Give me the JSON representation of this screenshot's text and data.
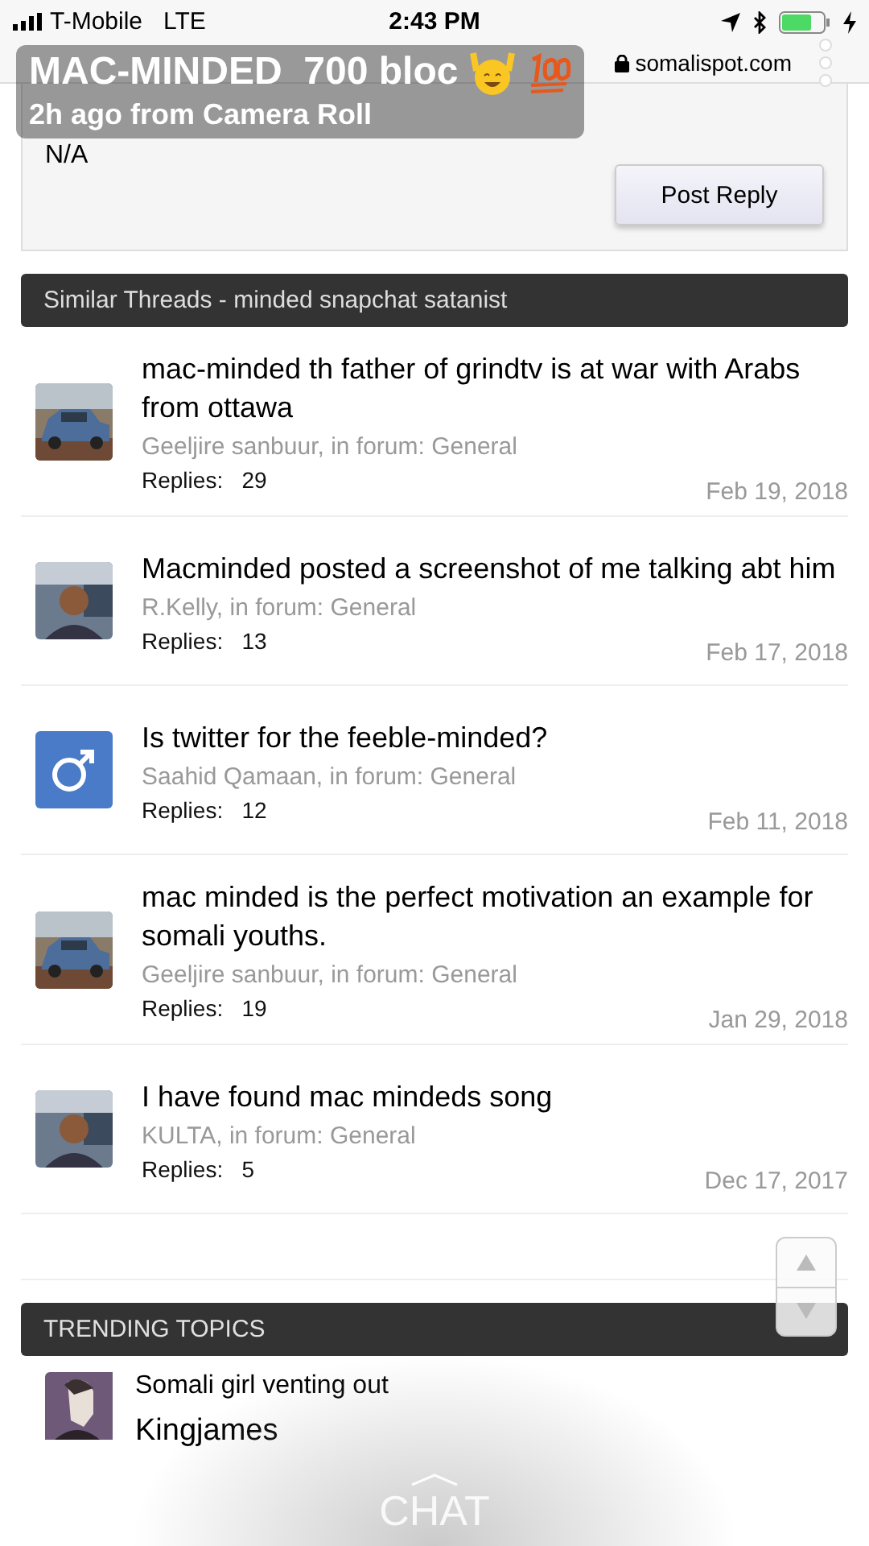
{
  "status_bar": {
    "carrier": "T-Mobile",
    "network": "LTE",
    "time": "2:43 PM"
  },
  "address_bar": {
    "url": "somalispot.com"
  },
  "snap_overlay": {
    "caption": "MAC-MINDED  700 bloc",
    "subtitle": "2h ago from Camera Roll",
    "chat_label": "CHAT"
  },
  "reply_box": {
    "value": "N/A",
    "button": "Post Reply"
  },
  "similar_threads": {
    "title": "Similar Threads - minded snapchat satanist",
    "threads": [
      {
        "title": "mac-minded th father of grindtv is at war with Arabs from ottawa",
        "meta": "Geeljire sanbuur, in forum: General",
        "replies_label": "Replies:",
        "replies": "29",
        "date": "Feb 19, 2018",
        "kind": "car"
      },
      {
        "title": "Macminded posted a screenshot of me talking abt him",
        "meta": "R.Kelly, in forum: General",
        "replies_label": "Replies:",
        "replies": "13",
        "date": "Feb 17, 2018",
        "kind": "person"
      },
      {
        "title": "Is twitter for the feeble-minded?",
        "meta": "Saahid Qamaan, in forum: General",
        "replies_label": "Replies:",
        "replies": "12",
        "date": "Feb 11, 2018",
        "kind": "male-sign"
      },
      {
        "title": "mac minded is the perfect motivation an example for somali youths.",
        "meta": "Geeljire sanbuur, in forum: General",
        "replies_label": "Replies:",
        "replies": "19",
        "date": "Jan 29, 2018",
        "kind": "car"
      },
      {
        "title": "I have found mac mindeds song",
        "meta": "KULTA, in forum: General",
        "replies_label": "Replies:",
        "replies": "5",
        "date": "Dec 17, 2017",
        "kind": "person"
      }
    ]
  },
  "trending": {
    "title": "TRENDING TOPICS",
    "items": [
      {
        "title": "Somali girl venting out",
        "author": "Kingjames"
      }
    ]
  }
}
